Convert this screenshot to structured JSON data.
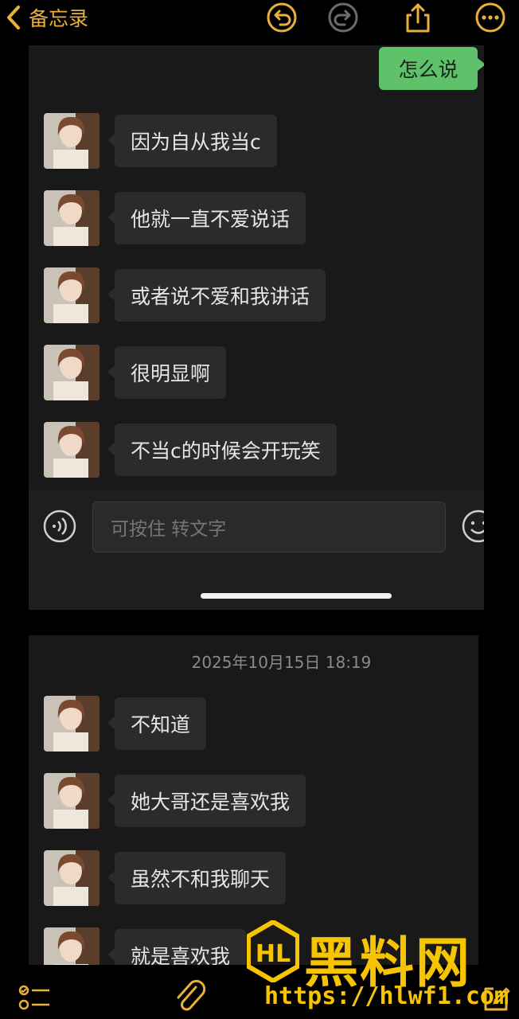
{
  "header": {
    "back_label": "备忘录"
  },
  "colors": {
    "accent": "#e9b13a",
    "sent_bubble": "#5fc26a",
    "received_bubble": "#2b2b2b",
    "watermark": "#f6c400"
  },
  "chat1": {
    "sent": "怎么说",
    "messages": [
      "因为自从我当c",
      "他就一直不爱说话",
      "或者说不爱和我讲话",
      "很明显啊",
      "不当c的时候会开玩笑"
    ],
    "input_placeholder": "可按住 转文字"
  },
  "chat2": {
    "timestamp": "2025年10月15日 18:19",
    "messages": [
      "不知道",
      "她大哥还是喜欢我",
      "虽然不和我聊天",
      "就是喜欢我"
    ]
  },
  "watermark": {
    "logo_text": "HL",
    "brand": "黑料网",
    "url": "https://hlwf1.com"
  },
  "icons": [
    "chevron-left-icon",
    "undo-icon",
    "redo-icon",
    "share-icon",
    "more-icon",
    "voice-icon",
    "emoji-icon",
    "checklist-icon",
    "attachment-icon",
    "compose-icon"
  ]
}
